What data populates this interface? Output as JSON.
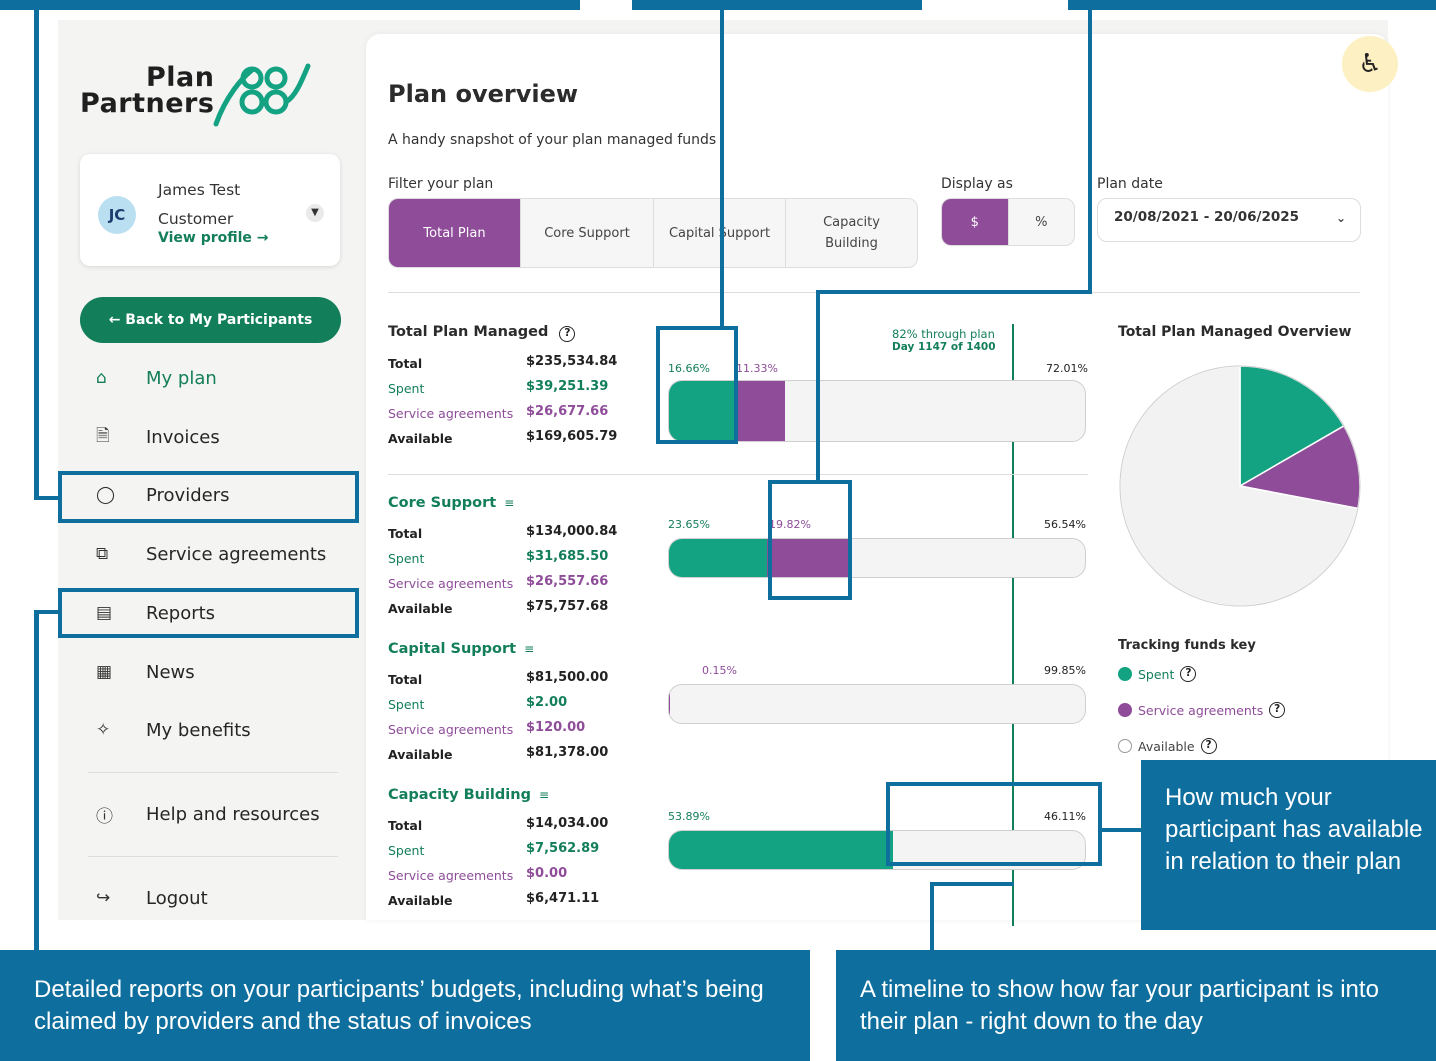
{
  "brand": {
    "line1": "Plan",
    "line2": "Partners"
  },
  "profile": {
    "initials": "JC",
    "name_first": "James Test",
    "name_last": "Customer",
    "view_profile": "View profile →"
  },
  "back_button": "←  Back to My Participants",
  "nav": {
    "my_plan": "My plan",
    "invoices": "Invoices",
    "providers": "Providers",
    "service_agreements": "Service agreements",
    "reports": "Reports",
    "news": "News",
    "my_benefits": "My benefits",
    "help": "Help and resources",
    "logout": "Logout"
  },
  "main": {
    "title": "Plan overview",
    "subtitle": "A handy snapshot of your plan managed funds",
    "filter_label": "Filter your plan",
    "filters": [
      "Total Plan",
      "Core Support",
      "Capital Support",
      "Capacity Building"
    ],
    "display_label": "Display as",
    "display_options": [
      "$",
      "%"
    ],
    "plan_date_label": "Plan date",
    "plan_date_value": "20/08/2021 - 20/06/2025"
  },
  "timeline": {
    "through": "82% through plan",
    "day": "Day 1147 of 1400"
  },
  "row_labels": {
    "total": "Total",
    "spent": "Spent",
    "service": "Service agreements",
    "available": "Available"
  },
  "sections": [
    {
      "title": "Total Plan Managed",
      "total": "$235,534.84",
      "spent": "$39,251.39",
      "service": "$26,677.66",
      "available": "$169,605.79",
      "pct_spent": "16.66%",
      "pct_service": "11.33%",
      "pct_available": "72.01%",
      "spent_frac": 0.1666,
      "service_frac": 0.1133
    },
    {
      "title": "Core Support",
      "total": "$134,000.84",
      "spent": "$31,685.50",
      "service": "$26,557.66",
      "available": "$75,757.68",
      "pct_spent": "23.65%",
      "pct_service": "19.82%",
      "pct_available": "56.54%",
      "spent_frac": 0.2365,
      "service_frac": 0.1982
    },
    {
      "title": "Capital Support",
      "total": "$81,500.00",
      "spent": "$2.00",
      "service": "$120.00",
      "available": "$81,378.00",
      "pct_spent": "",
      "pct_service": "0.15%",
      "pct_available": "99.85%",
      "spent_frac": 0.0,
      "service_frac": 0.0015
    },
    {
      "title": "Capacity Building",
      "total": "$14,034.00",
      "spent": "$7,562.89",
      "service": "$0.00",
      "available": "$6,471.11",
      "pct_spent": "53.89%",
      "pct_service": "",
      "pct_available": "46.11%",
      "spent_frac": 0.5389,
      "service_frac": 0.0
    }
  ],
  "overview": {
    "title": "Total Plan Managed Overview",
    "key_title": "Tracking funds key",
    "key": [
      "Spent",
      "Service agreements",
      "Available"
    ]
  },
  "colors": {
    "spent": "#14a382",
    "service": "#8e4c99",
    "available": "#f2f2f2",
    "brand_green": "#137e5a",
    "callout": "#0e6f9e"
  },
  "chart_data": {
    "type": "pie",
    "title": "Total Plan Managed Overview",
    "labels": [
      "Spent",
      "Service agreements",
      "Available"
    ],
    "values": [
      16.66,
      11.33,
      72.01
    ]
  },
  "callouts": {
    "available": "How much your participant has available in relation to their plan",
    "reports": "Detailed reports on your participants’ budgets, including what’s being claimed by providers and the status of invoices",
    "timeline": "A timeline to show how far your participant is into their plan - right down to the day"
  }
}
